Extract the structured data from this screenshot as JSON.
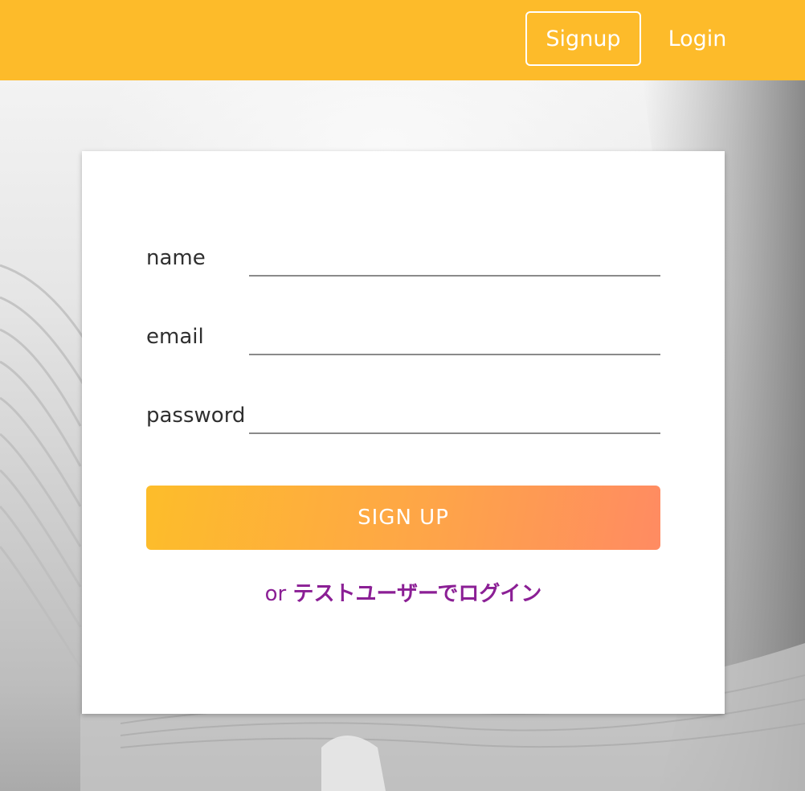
{
  "header": {
    "background_color": "#fdbb2a",
    "signup_label": "Signup",
    "login_label": "Login"
  },
  "form": {
    "fields": [
      {
        "label": "name",
        "value": "",
        "type": "text"
      },
      {
        "label": "email",
        "value": "",
        "type": "email"
      },
      {
        "label": "password",
        "value": "",
        "type": "password"
      }
    ],
    "submit_label": "SIGN UP",
    "alt_prefix": "or",
    "alt_link": "テストユーザーでログイン"
  },
  "colors": {
    "accent_start": "#fdbd2a",
    "accent_end": "#ff8b62",
    "link": "#8b1f95"
  }
}
